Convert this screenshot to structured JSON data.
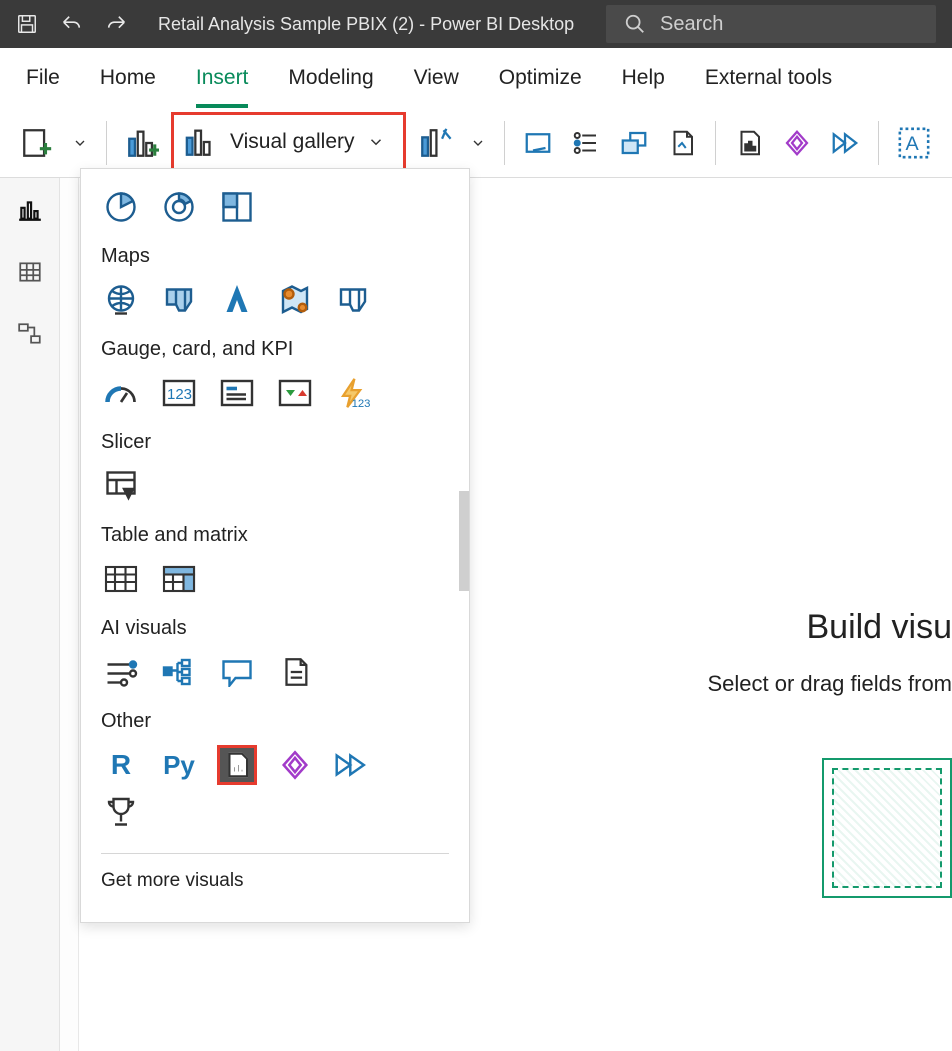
{
  "titlebar": {
    "title": "Retail Analysis Sample PBIX (2) - Power BI Desktop"
  },
  "search": {
    "placeholder": "Search"
  },
  "menus": {
    "file": "File",
    "home": "Home",
    "insert": "Insert",
    "modeling": "Modeling",
    "view": "View",
    "optimize": "Optimize",
    "help": "Help",
    "external": "External tools"
  },
  "ribbon": {
    "visual_gallery": "Visual gallery"
  },
  "dropdown": {
    "maps": "Maps",
    "gauge": "Gauge, card, and KPI",
    "slicer": "Slicer",
    "table": "Table and matrix",
    "ai": "AI visuals",
    "other": "Other",
    "more": "Get more visuals"
  },
  "canvas": {
    "build_title": "Build visu",
    "build_sub": "Select or drag fields from "
  },
  "other_labels": {
    "r": "R",
    "py": "Py"
  }
}
